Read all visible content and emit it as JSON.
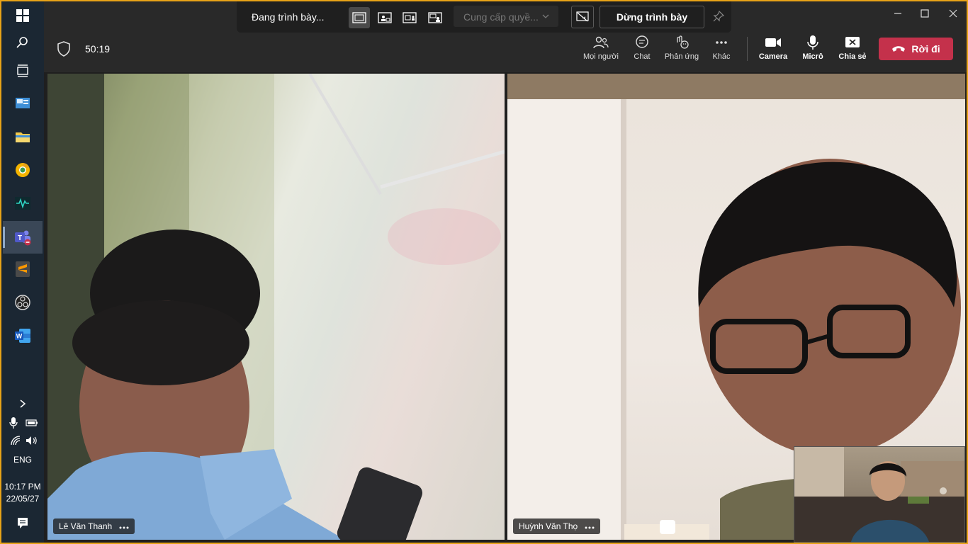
{
  "presenting_bar": {
    "status": "Đang trình bày...",
    "give_control_label": "Cung cấp quyề...",
    "stop_presenting_label": "Dừng trình bày"
  },
  "meeting": {
    "timer": "50:19"
  },
  "toolbar": {
    "people": "Mọi người",
    "chat": "Chat",
    "reactions": "Phản ứng",
    "more": "Khác",
    "camera": "Camera",
    "mic": "Micrô",
    "share": "Chia sẻ",
    "leave": "Rời đi"
  },
  "participants": [
    {
      "name": "Lê Văn Thanh"
    },
    {
      "name": "Huỳnh Văn Thọ"
    }
  ],
  "system_tray": {
    "language": "ENG",
    "time": "10:17 PM",
    "date": "22/05/27"
  },
  "colors": {
    "leave_button": "#c4314b",
    "accent_border": "#e8a317",
    "taskbar": "#1b2733"
  },
  "taskbar_apps": [
    "windows-start-icon",
    "search-icon",
    "task-view-icon",
    "control-panel-icon",
    "file-explorer-icon",
    "chrome-canary-icon",
    "audio-app-icon",
    "teams-icon",
    "sublime-text-icon",
    "obs-icon",
    "word-icon"
  ]
}
